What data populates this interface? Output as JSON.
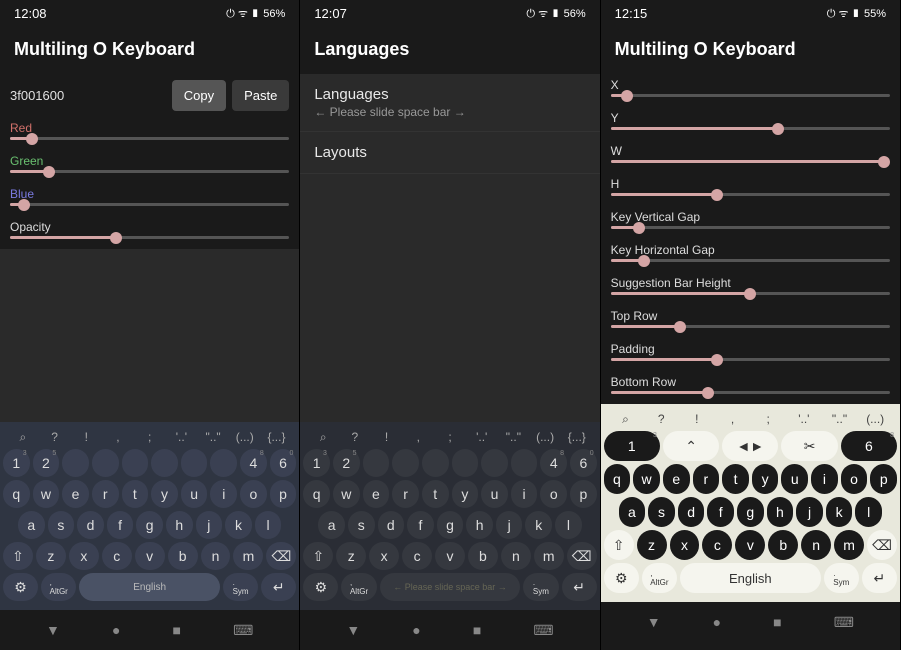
{
  "phones": [
    {
      "time": "12:08",
      "battery": "56%",
      "title": "Multiling O Keyboard",
      "hex": "3f001600",
      "copy": "Copy",
      "paste": "Paste",
      "sliders": [
        {
          "label": "Red",
          "cls": "red",
          "pos": 8
        },
        {
          "label": "Green",
          "cls": "green",
          "pos": 14
        },
        {
          "label": "Blue",
          "cls": "blue",
          "pos": 5
        },
        {
          "label": "Opacity",
          "cls": "white",
          "pos": 38
        }
      ],
      "kb_theme": "",
      "toprow": [
        "⌕",
        "?",
        "!",
        ",",
        ";",
        "'..'",
        "\"..\"",
        "(...)",
        "{...}"
      ],
      "row1": [
        {
          "m": "1",
          "s": "3"
        },
        {
          "m": "2",
          "s": "5"
        },
        {
          "m": "",
          "s": ""
        },
        {
          "m": "",
          "s": ""
        },
        {
          "m": "",
          "s": ""
        },
        {
          "m": "",
          "s": ""
        },
        {
          "m": "",
          "s": ""
        },
        {
          "m": "",
          "s": ""
        },
        {
          "m": "4",
          "s": "8"
        },
        {
          "m": "6",
          "s": "0"
        }
      ],
      "row2": [
        "q",
        "w",
        "e",
        "r",
        "t",
        "y",
        "u",
        "i",
        "o",
        "p"
      ],
      "row3": [
        "a",
        "s",
        "d",
        "f",
        "g",
        "h",
        "j",
        "k",
        "l"
      ],
      "row4_left": "⇧",
      "row4": [
        "z",
        "x",
        "c",
        "v",
        "b",
        "n",
        "m"
      ],
      "row4_right": "⌫",
      "row5": {
        "gear": "⚙",
        "altgr": "AltGr",
        "space": "English",
        "sym": "Sym",
        "enter": "↵"
      }
    },
    {
      "time": "12:07",
      "battery": "56%",
      "title": "Languages",
      "items": [
        {
          "t": "Languages",
          "s": "← Please slide space bar →"
        },
        {
          "t": "Layouts",
          "s": ""
        }
      ],
      "kb_theme": "dark",
      "toprow": [
        "⌕",
        "?",
        "!",
        ",",
        ";",
        "'..'",
        "\"..\"",
        "(...)",
        "{...}"
      ],
      "row1": [
        {
          "m": "1",
          "s": "3"
        },
        {
          "m": "2",
          "s": "5"
        },
        {
          "m": "",
          "s": ""
        },
        {
          "m": "",
          "s": ""
        },
        {
          "m": "",
          "s": ""
        },
        {
          "m": "",
          "s": ""
        },
        {
          "m": "",
          "s": ""
        },
        {
          "m": "",
          "s": ""
        },
        {
          "m": "4",
          "s": "8"
        },
        {
          "m": "6",
          "s": "0"
        }
      ],
      "row2": [
        "q",
        "w",
        "e",
        "r",
        "t",
        "y",
        "u",
        "i",
        "o",
        "p"
      ],
      "row3": [
        "a",
        "s",
        "d",
        "f",
        "g",
        "h",
        "j",
        "k",
        "l"
      ],
      "row4_left": "⇧",
      "row4": [
        "z",
        "x",
        "c",
        "v",
        "b",
        "n",
        "m"
      ],
      "row4_right": "⌫",
      "row5": {
        "gear": "⚙",
        "altgr": "AltGr",
        "space": "← Please slide space bar →",
        "sym": "Sym",
        "enter": "↵"
      }
    },
    {
      "time": "12:15",
      "battery": "55%",
      "title": "Multiling O Keyboard",
      "sliders": [
        {
          "label": "X",
          "cls": "white",
          "pos": 6
        },
        {
          "label": "Y",
          "cls": "white",
          "pos": 60
        },
        {
          "label": "W",
          "cls": "white",
          "pos": 98
        },
        {
          "label": "H",
          "cls": "white",
          "pos": 38
        },
        {
          "label": "Key Vertical Gap",
          "cls": "white",
          "pos": 10
        },
        {
          "label": "Key Horizontal Gap",
          "cls": "white",
          "pos": 12
        },
        {
          "label": "Suggestion Bar Height",
          "cls": "white",
          "pos": 50
        },
        {
          "label": "Top Row",
          "cls": "white",
          "pos": 25
        },
        {
          "label": "Padding",
          "cls": "white",
          "pos": 38
        },
        {
          "label": "Bottom Row",
          "cls": "white",
          "pos": 35
        }
      ],
      "kb_theme": "light",
      "toprow": [
        "⌕",
        "?",
        "!",
        ",",
        ";",
        "'..'",
        "\"..\"",
        "(...)"
      ],
      "row1": [
        {
          "m": "1",
          "s": "3",
          "bg": "black"
        },
        {
          "m": "⌃",
          "s": "",
          "bg": "white"
        },
        {
          "m": "◄►",
          "s": "",
          "bg": "white"
        },
        {
          "m": "✂",
          "s": "",
          "bg": "white"
        },
        {
          "m": "6",
          "s": "8",
          "bg": "black"
        }
      ],
      "row2": [
        "q",
        "w",
        "e",
        "r",
        "t",
        "y",
        "u",
        "i",
        "o",
        "p"
      ],
      "row3": [
        "a",
        "s",
        "d",
        "f",
        "g",
        "h",
        "j",
        "k",
        "l"
      ],
      "row4_left": "⇧",
      "row4": [
        "z",
        "x",
        "c",
        "v",
        "b",
        "n",
        "m"
      ],
      "row4_right": "⌫",
      "row5": {
        "gear": "⚙",
        "altgr": "AltGr",
        "space": "English",
        "sym": "Sym",
        "enter": "↵"
      }
    }
  ],
  "nav": {
    "back": "▼",
    "home": "●",
    "recent": "■",
    "kb": "⌨"
  }
}
